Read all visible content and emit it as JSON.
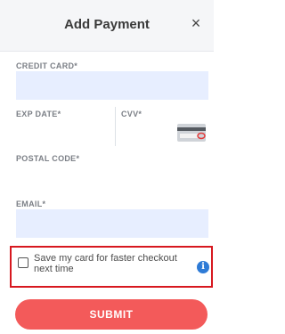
{
  "header": {
    "title": "Add Payment",
    "close_icon": "×"
  },
  "form": {
    "credit_card": {
      "label": "CREDIT CARD*",
      "value": ""
    },
    "exp_date": {
      "label": "EXP DATE*",
      "value": ""
    },
    "cvv": {
      "label": "CVV*",
      "value": ""
    },
    "postal_code": {
      "label": "POSTAL CODE*",
      "value": ""
    },
    "email": {
      "label": "EMAIL*",
      "value": ""
    }
  },
  "save_card": {
    "label": "Save my card for faster checkout next time",
    "checked": false,
    "info_icon": "i"
  },
  "submit": {
    "label": "SUBMIT"
  },
  "colors": {
    "field_bg": "#e7eeff",
    "highlight_border": "#d7181f",
    "submit_bg": "#f35a5a",
    "info_icon": "#2e7bd6"
  }
}
